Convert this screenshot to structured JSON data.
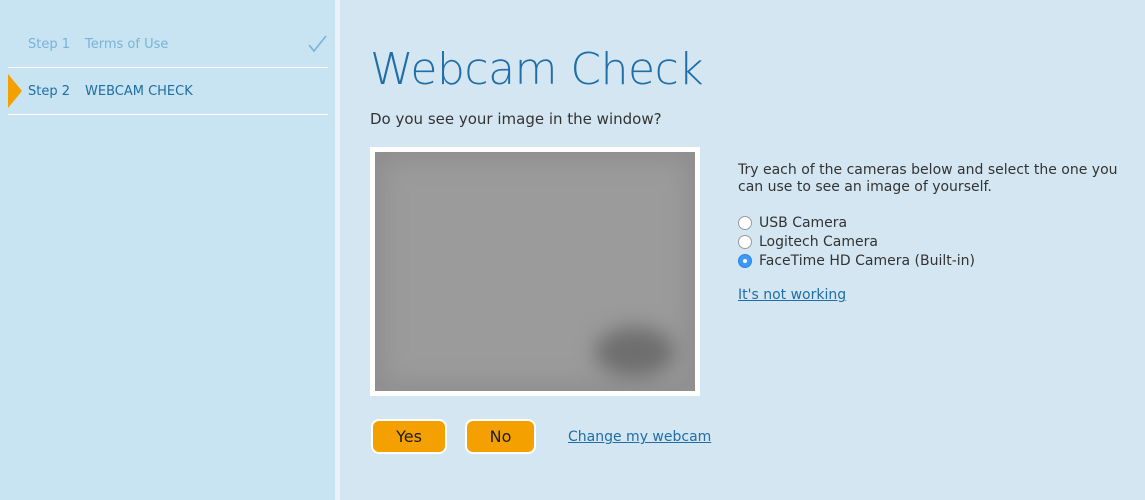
{
  "sidebar": {
    "steps": [
      {
        "num": "Step 1",
        "label": "Terms of Use",
        "status": "done"
      },
      {
        "num": "Step 2",
        "label": "WEBCAM CHECK",
        "status": "current"
      }
    ]
  },
  "main": {
    "title": "Webcam Check",
    "question": "Do you see your image in the window?",
    "instructions": "Try each of the cameras below and select the one you can use to see an image of yourself.",
    "cameras": [
      {
        "label": "USB Camera",
        "selected": false
      },
      {
        "label": "Logitech Camera",
        "selected": false
      },
      {
        "label": "FaceTime HD Camera (Built-in)",
        "selected": true
      }
    ],
    "not_working_link": "It's not working",
    "yes_button": "Yes",
    "no_button": "No",
    "change_link": "Change my webcam"
  },
  "colors": {
    "accent": "#f3a000",
    "title": "#1f6ea7",
    "background": "#d4e6f1",
    "sidebar": "#c8e3f1"
  }
}
